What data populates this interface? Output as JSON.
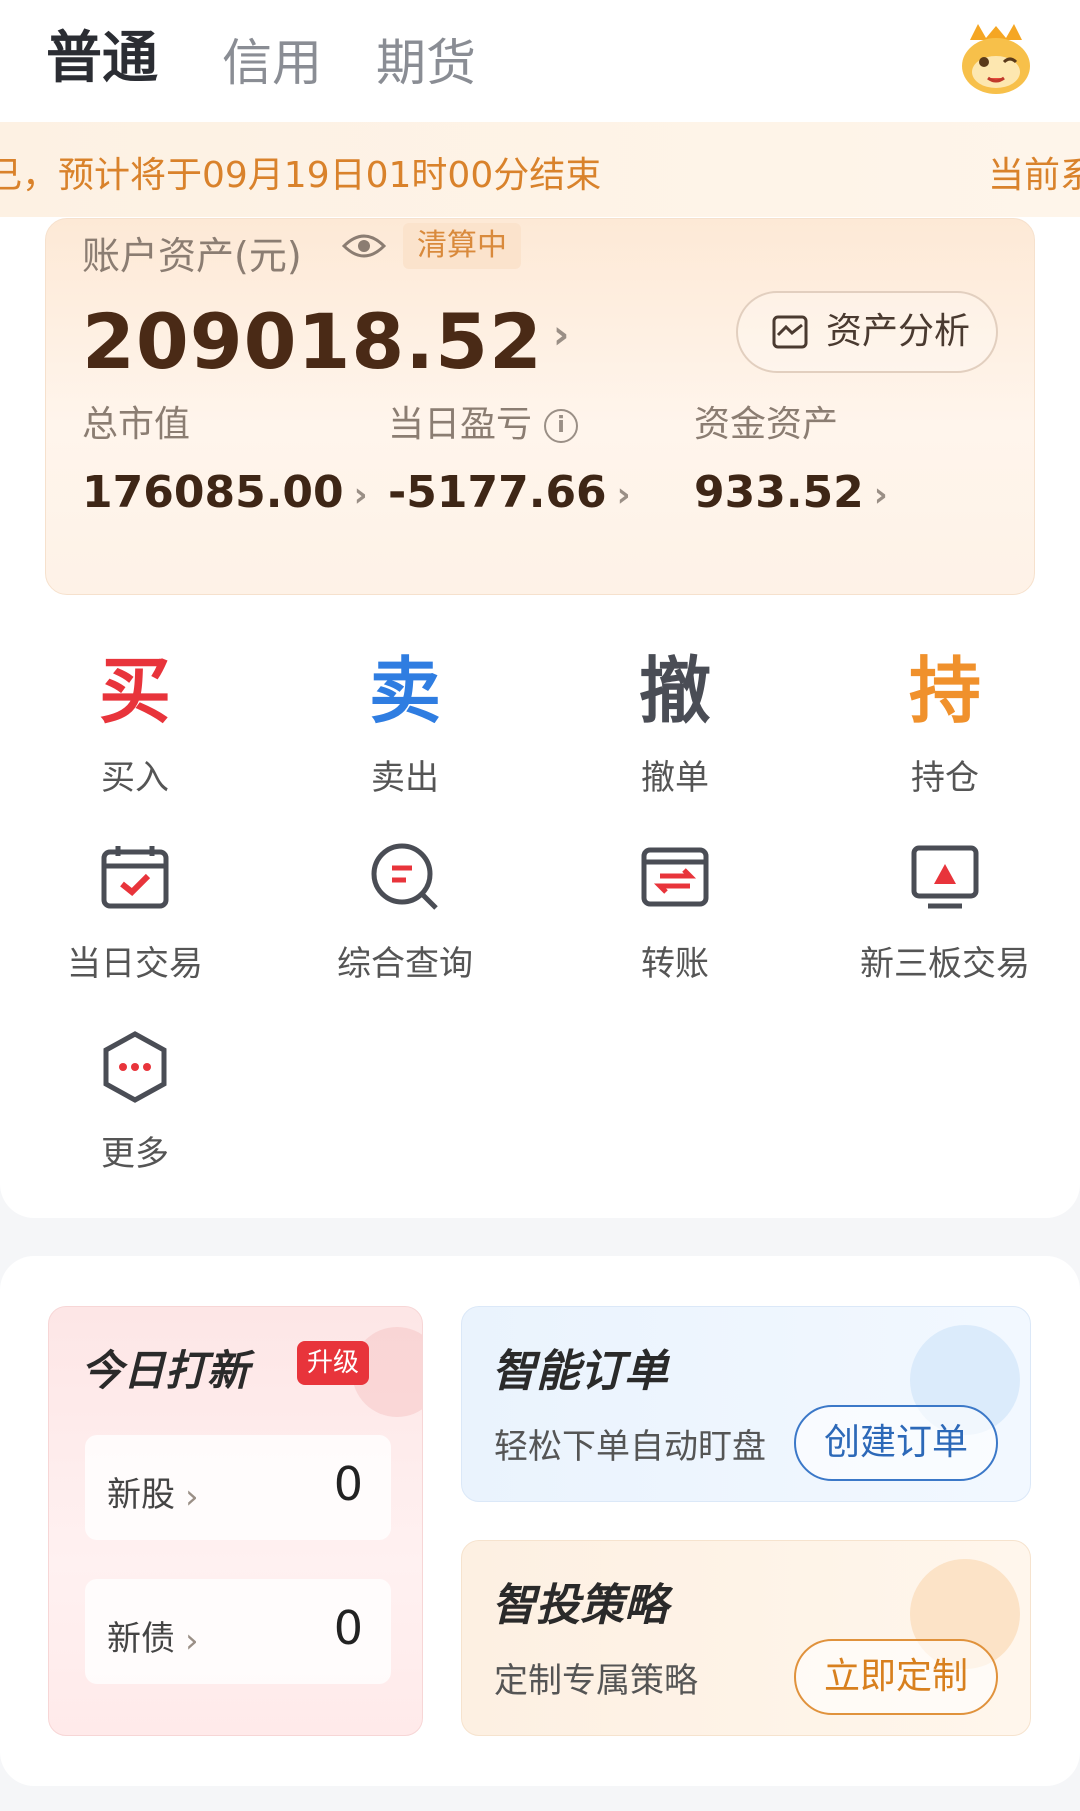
{
  "tabs": [
    {
      "label": "普通",
      "active": true
    },
    {
      "label": "信用",
      "active": false
    },
    {
      "label": "期货",
      "active": false
    }
  ],
  "notice": {
    "message": "己，预计将于09月19日01时00分结束",
    "right_text": "当前系"
  },
  "account": {
    "label": "账户资产(元)",
    "status": "清算中",
    "total": "209018.52",
    "analysis_button": "资产分析",
    "metrics": [
      {
        "label": "总市值",
        "value": "176085.00"
      },
      {
        "label": "当日盈亏",
        "value": "-5177.66"
      },
      {
        "label": "资金资产",
        "value": "933.52"
      }
    ]
  },
  "actions": [
    {
      "glyph": "买",
      "label": "买入",
      "color": "#e8343b"
    },
    {
      "glyph": "卖",
      "label": "卖出",
      "color": "#2f7de1"
    },
    {
      "glyph": "撤",
      "label": "撤单",
      "color": "#4a4d55"
    },
    {
      "glyph": "持",
      "label": "持仓",
      "color": "#f0912c"
    }
  ],
  "tools": [
    {
      "label": "当日交易",
      "icon": "calendar-check-icon"
    },
    {
      "label": "综合查询",
      "icon": "search-list-icon"
    },
    {
      "label": "转账",
      "icon": "transfer-card-icon"
    },
    {
      "label": "新三板交易",
      "icon": "monitor-chart-icon"
    },
    {
      "label": "更多",
      "icon": "more-dots-icon"
    }
  ],
  "ipo": {
    "title": "今日打新",
    "badge": "升级",
    "rows": [
      {
        "label": "新股",
        "count": "0"
      },
      {
        "label": "新债",
        "count": "0"
      }
    ]
  },
  "promos": [
    {
      "title": "智能订单",
      "subtitle": "轻松下单自动盯盘",
      "button": "创建订单"
    },
    {
      "title": "智投策略",
      "subtitle": "定制专属策略",
      "button": "立即定制"
    }
  ]
}
